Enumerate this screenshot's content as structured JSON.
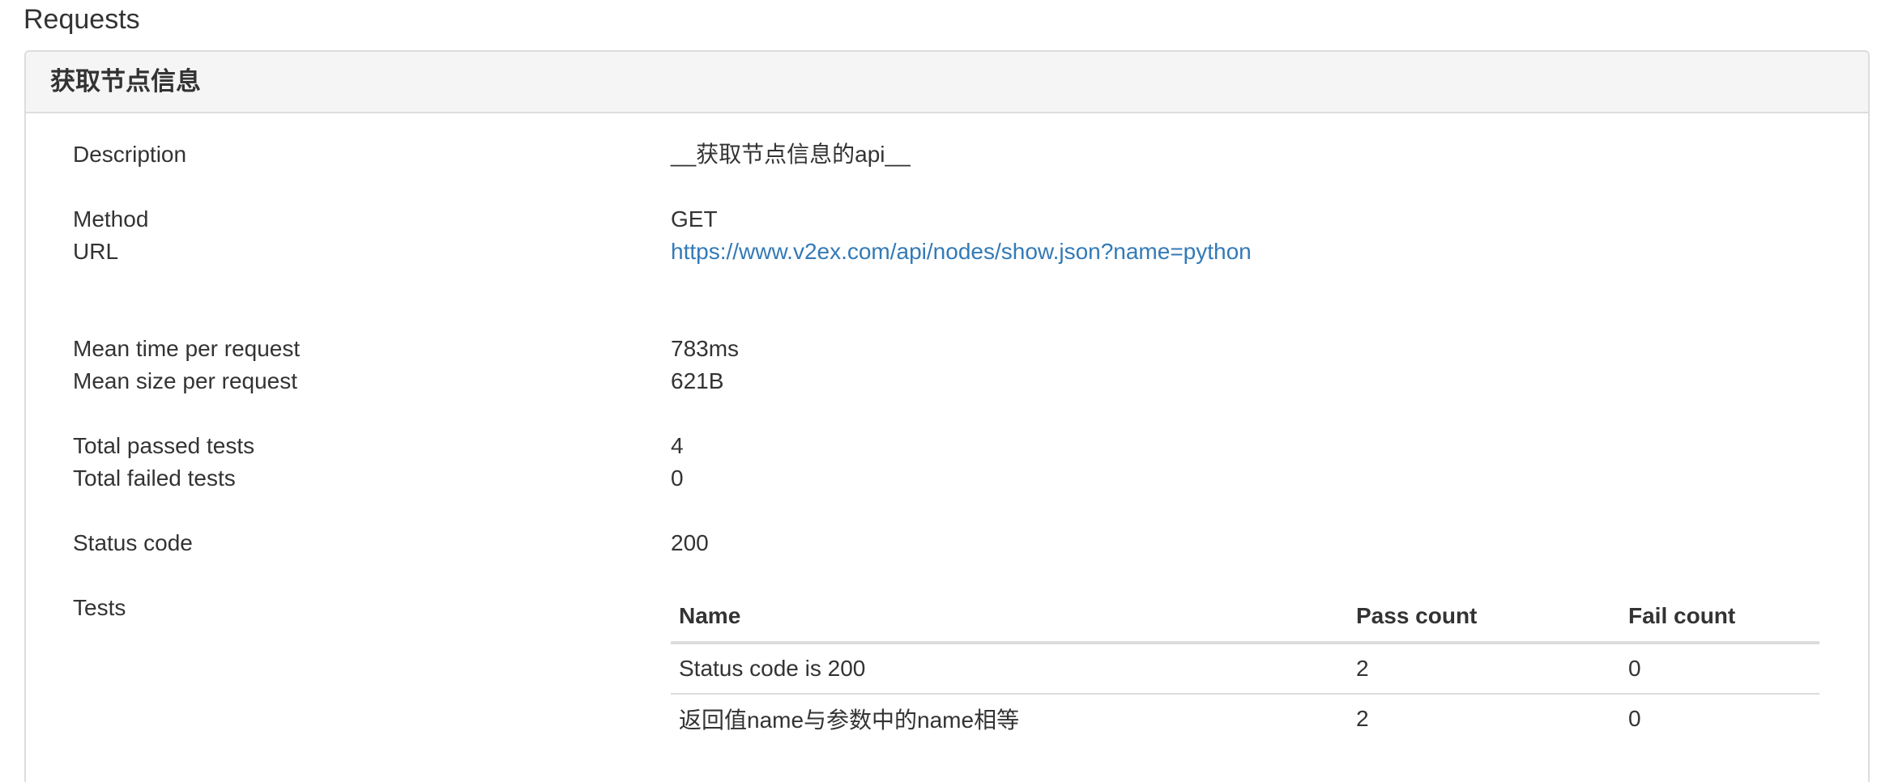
{
  "section": {
    "title": "Requests"
  },
  "request": {
    "name": "获取节点信息",
    "description_label": "Description",
    "description": "__获取节点信息的api__",
    "method_label": "Method",
    "method": "GET",
    "url_label": "URL",
    "url": "https://www.v2ex.com/api/nodes/show.json?name=python",
    "mean_time_label": "Mean time per request",
    "mean_time": "783ms",
    "mean_size_label": "Mean size per request",
    "mean_size": "621B",
    "passed_label": "Total passed tests",
    "passed": "4",
    "failed_label": "Total failed tests",
    "failed": "0",
    "status_label": "Status code",
    "status": "200",
    "tests_label": "Tests"
  },
  "tests_table": {
    "headers": [
      "Name",
      "Pass count",
      "Fail count"
    ],
    "rows": [
      {
        "name": "Status code is 200",
        "pass": "2",
        "fail": "0"
      },
      {
        "name": "返回值name与参数中的name相等",
        "pass": "2",
        "fail": "0"
      }
    ]
  },
  "colors": {
    "link": "#337ab7",
    "panel_heading_bg": "#f5f5f5",
    "border": "#dddddd",
    "text": "#333333"
  }
}
